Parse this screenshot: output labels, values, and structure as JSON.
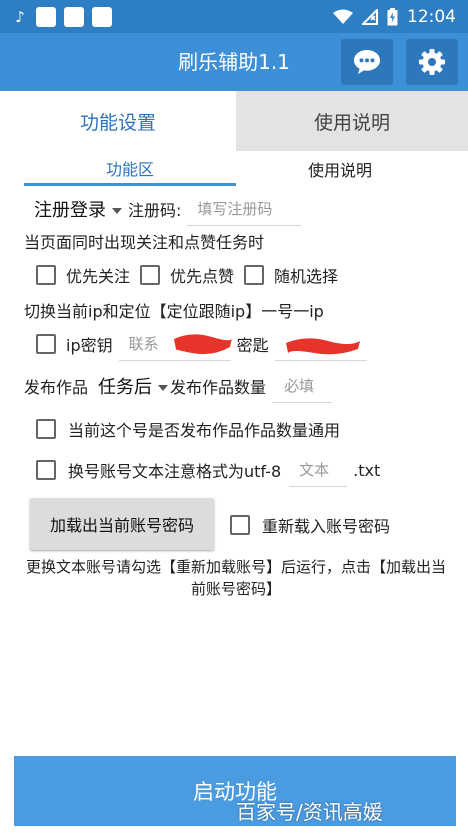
{
  "status_bar": {
    "time": "12:04",
    "icons": [
      "tiktok-icon",
      "notification-square-icon",
      "notification-square-icon",
      "notification-square-icon",
      "wifi-icon",
      "no-signal-icon",
      "battery-charging-icon"
    ]
  },
  "app_bar": {
    "title": "刷乐辅助1.1",
    "chat_icon": "chat-bubble-icon",
    "settings_icon": "gear-icon"
  },
  "tabs": [
    {
      "label": "功能设置",
      "active": true
    },
    {
      "label": "使用说明",
      "active": false
    }
  ],
  "subtabs": [
    {
      "label": "功能区",
      "active": true
    },
    {
      "label": "使用说明",
      "active": false
    }
  ],
  "form": {
    "login_mode": "注册登录",
    "reg_code_label": "注册码:",
    "reg_code_placeholder": "填写注册码",
    "task_prompt": "当页面同时出现关注和点赞任务时",
    "options": [
      "优先关注",
      "优先点赞",
      "随机选择"
    ],
    "ip_switch_label": "切换当前ip和定位【定位跟随ip】一号一ip",
    "ip_key_label": "ip密钥",
    "ip_key_value": "联系",
    "password_label": "密匙",
    "publish_label": "发布作品",
    "publish_mode": "任务后",
    "publish_count_label": "发布作品数量",
    "publish_count_placeholder": "必填",
    "common_label": "当前这个号是否发布作品作品数量通用",
    "switch_label": "换号账号文本注意格式为utf-8",
    "text_placeholder": "文本",
    "text_ext": ".txt",
    "load_button": "加载出当前账号密码",
    "reload_label": "重新载入账号密码",
    "note": "更换文本账号请勾选【重新加载账号】后运行，点击【加载出当前账号密码】"
  },
  "start_button": "启动功能",
  "watermark": "百家号/资讯高媛",
  "colors": {
    "status_bar": "#2e7ec3",
    "app_bar": "#3d8fd8",
    "accent": "#2e73b8",
    "start_button": "#4b9be0",
    "redaction": "#e8332a"
  }
}
